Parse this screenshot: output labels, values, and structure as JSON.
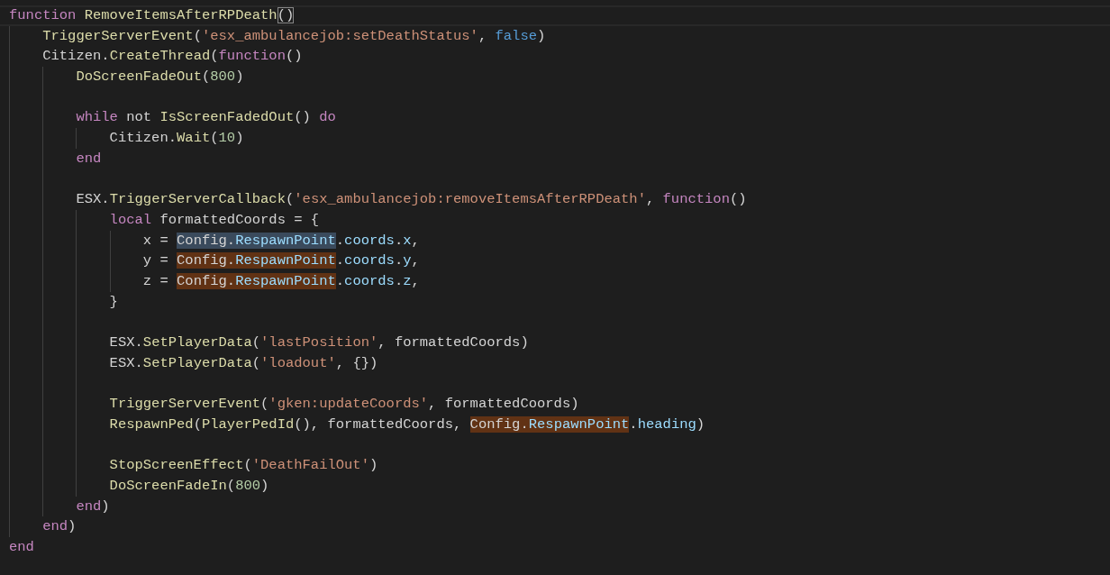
{
  "editor": {
    "lines": [
      {
        "current": true,
        "tokens": [
          {
            "kind": "keyword",
            "text": "function "
          },
          {
            "kind": "function",
            "text": "RemoveItemsAfterRPDeath"
          },
          {
            "kind": "plain",
            "text": "()",
            "bracket_match": true
          }
        ],
        "children": [
          {
            "tokens": [
              {
                "kind": "function",
                "text": "TriggerServerEvent"
              },
              {
                "kind": "plain",
                "text": "("
              },
              {
                "kind": "string",
                "text": "'esx_ambulancejob:setDeathStatus'"
              },
              {
                "kind": "plain",
                "text": ", "
              },
              {
                "kind": "boolean",
                "text": "false"
              },
              {
                "kind": "plain",
                "text": ")"
              }
            ]
          },
          {
            "tokens": [
              {
                "kind": "plain",
                "text": "Citizen."
              },
              {
                "kind": "function",
                "text": "CreateThread"
              },
              {
                "kind": "plain",
                "text": "("
              },
              {
                "kind": "keyword",
                "text": "function"
              },
              {
                "kind": "plain",
                "text": "()"
              }
            ],
            "children": [
              {
                "tokens": [
                  {
                    "kind": "function",
                    "text": "DoScreenFadeOut"
                  },
                  {
                    "kind": "plain",
                    "text": "("
                  },
                  {
                    "kind": "number",
                    "text": "800"
                  },
                  {
                    "kind": "plain",
                    "text": ")"
                  }
                ]
              },
              {
                "blank_line_before": true,
                "tokens": [
                  {
                    "kind": "keyword",
                    "text": "while"
                  },
                  {
                    "kind": "plain",
                    "text": " not "
                  },
                  {
                    "kind": "function",
                    "text": "IsScreenFadedOut"
                  },
                  {
                    "kind": "plain",
                    "text": "() "
                  },
                  {
                    "kind": "keyword",
                    "text": "do"
                  }
                ],
                "children": [
                  {
                    "tokens": [
                      {
                        "kind": "plain",
                        "text": "Citizen."
                      },
                      {
                        "kind": "function",
                        "text": "Wait"
                      },
                      {
                        "kind": "plain",
                        "text": "("
                      },
                      {
                        "kind": "number",
                        "text": "10"
                      },
                      {
                        "kind": "plain",
                        "text": ")"
                      }
                    ]
                  }
                ]
              },
              {
                "tokens": [
                  {
                    "kind": "keyword",
                    "text": "end"
                  }
                ]
              },
              {
                "blank_line_before": true,
                "tokens": [
                  {
                    "kind": "plain",
                    "text": "ESX."
                  },
                  {
                    "kind": "function",
                    "text": "TriggerServerCallback"
                  },
                  {
                    "kind": "plain",
                    "text": "("
                  },
                  {
                    "kind": "string",
                    "text": "'esx_ambulancejob:removeItemsAfterRPDeath'"
                  },
                  {
                    "kind": "plain",
                    "text": ", "
                  },
                  {
                    "kind": "keyword",
                    "text": "function"
                  },
                  {
                    "kind": "plain",
                    "text": "()"
                  }
                ],
                "children": [
                  {
                    "tokens": [
                      {
                        "kind": "keyword",
                        "text": "local"
                      },
                      {
                        "kind": "plain",
                        "text": " formattedCoords = {"
                      }
                    ],
                    "children": [
                      {
                        "tokens": [
                          {
                            "kind": "plain",
                            "text": "x = "
                          },
                          {
                            "kind": "plain",
                            "text": "Config.",
                            "selected": true
                          },
                          {
                            "kind": "property",
                            "text": "RespawnPoint",
                            "selected": true
                          },
                          {
                            "kind": "plain",
                            "text": "."
                          },
                          {
                            "kind": "property",
                            "text": "coords"
                          },
                          {
                            "kind": "plain",
                            "text": "."
                          },
                          {
                            "kind": "property",
                            "text": "x"
                          },
                          {
                            "kind": "plain",
                            "text": ","
                          }
                        ]
                      },
                      {
                        "tokens": [
                          {
                            "kind": "plain",
                            "text": "y = "
                          },
                          {
                            "kind": "plain",
                            "text": "Config.",
                            "match_highlighted": true
                          },
                          {
                            "kind": "property",
                            "text": "RespawnPoint",
                            "match_highlighted": true
                          },
                          {
                            "kind": "plain",
                            "text": "."
                          },
                          {
                            "kind": "property",
                            "text": "coords"
                          },
                          {
                            "kind": "plain",
                            "text": "."
                          },
                          {
                            "kind": "property",
                            "text": "y"
                          },
                          {
                            "kind": "plain",
                            "text": ","
                          }
                        ]
                      },
                      {
                        "tokens": [
                          {
                            "kind": "plain",
                            "text": "z = "
                          },
                          {
                            "kind": "plain",
                            "text": "Config.",
                            "match_highlighted": true
                          },
                          {
                            "kind": "property",
                            "text": "RespawnPoint",
                            "match_highlighted": true
                          },
                          {
                            "kind": "plain",
                            "text": "."
                          },
                          {
                            "kind": "property",
                            "text": "coords"
                          },
                          {
                            "kind": "plain",
                            "text": "."
                          },
                          {
                            "kind": "property",
                            "text": "z"
                          },
                          {
                            "kind": "plain",
                            "text": ","
                          }
                        ]
                      }
                    ]
                  },
                  {
                    "tokens": [
                      {
                        "kind": "plain",
                        "text": "}"
                      }
                    ]
                  },
                  {
                    "blank_line_before": true,
                    "tokens": [
                      {
                        "kind": "plain",
                        "text": "ESX."
                      },
                      {
                        "kind": "function",
                        "text": "SetPlayerData"
                      },
                      {
                        "kind": "plain",
                        "text": "("
                      },
                      {
                        "kind": "string",
                        "text": "'lastPosition'"
                      },
                      {
                        "kind": "plain",
                        "text": ", formattedCoords)"
                      }
                    ]
                  },
                  {
                    "tokens": [
                      {
                        "kind": "plain",
                        "text": "ESX."
                      },
                      {
                        "kind": "function",
                        "text": "SetPlayerData"
                      },
                      {
                        "kind": "plain",
                        "text": "("
                      },
                      {
                        "kind": "string",
                        "text": "'loadout'"
                      },
                      {
                        "kind": "plain",
                        "text": ", {})"
                      }
                    ]
                  },
                  {
                    "blank_line_before": true,
                    "tokens": [
                      {
                        "kind": "function",
                        "text": "TriggerServerEvent"
                      },
                      {
                        "kind": "plain",
                        "text": "("
                      },
                      {
                        "kind": "string",
                        "text": "'gken:updateCoords'"
                      },
                      {
                        "kind": "plain",
                        "text": ", formattedCoords)"
                      }
                    ]
                  },
                  {
                    "tokens": [
                      {
                        "kind": "function",
                        "text": "RespawnPed"
                      },
                      {
                        "kind": "plain",
                        "text": "("
                      },
                      {
                        "kind": "function",
                        "text": "PlayerPedId"
                      },
                      {
                        "kind": "plain",
                        "text": "(), formattedCoords, "
                      },
                      {
                        "kind": "plain",
                        "text": "Config.",
                        "match_highlighted": true
                      },
                      {
                        "kind": "property",
                        "text": "RespawnPoint",
                        "match_highlighted": true
                      },
                      {
                        "kind": "plain",
                        "text": "."
                      },
                      {
                        "kind": "property",
                        "text": "heading"
                      },
                      {
                        "kind": "plain",
                        "text": ")"
                      }
                    ]
                  },
                  {
                    "blank_line_before": true,
                    "tokens": [
                      {
                        "kind": "function",
                        "text": "StopScreenEffect"
                      },
                      {
                        "kind": "plain",
                        "text": "("
                      },
                      {
                        "kind": "string",
                        "text": "'DeathFailOut'"
                      },
                      {
                        "kind": "plain",
                        "text": ")"
                      }
                    ]
                  },
                  {
                    "tokens": [
                      {
                        "kind": "function",
                        "text": "DoScreenFadeIn"
                      },
                      {
                        "kind": "plain",
                        "text": "("
                      },
                      {
                        "kind": "number",
                        "text": "800"
                      },
                      {
                        "kind": "plain",
                        "text": ")"
                      }
                    ]
                  }
                ]
              },
              {
                "tokens": [
                  {
                    "kind": "keyword",
                    "text": "end"
                  },
                  {
                    "kind": "plain",
                    "text": ")"
                  }
                ]
              }
            ]
          },
          {
            "tokens": [
              {
                "kind": "keyword",
                "text": "end"
              },
              {
                "kind": "plain",
                "text": ")"
              }
            ]
          }
        ]
      },
      {
        "tokens": [
          {
            "kind": "keyword",
            "text": "end"
          }
        ]
      }
    ]
  }
}
